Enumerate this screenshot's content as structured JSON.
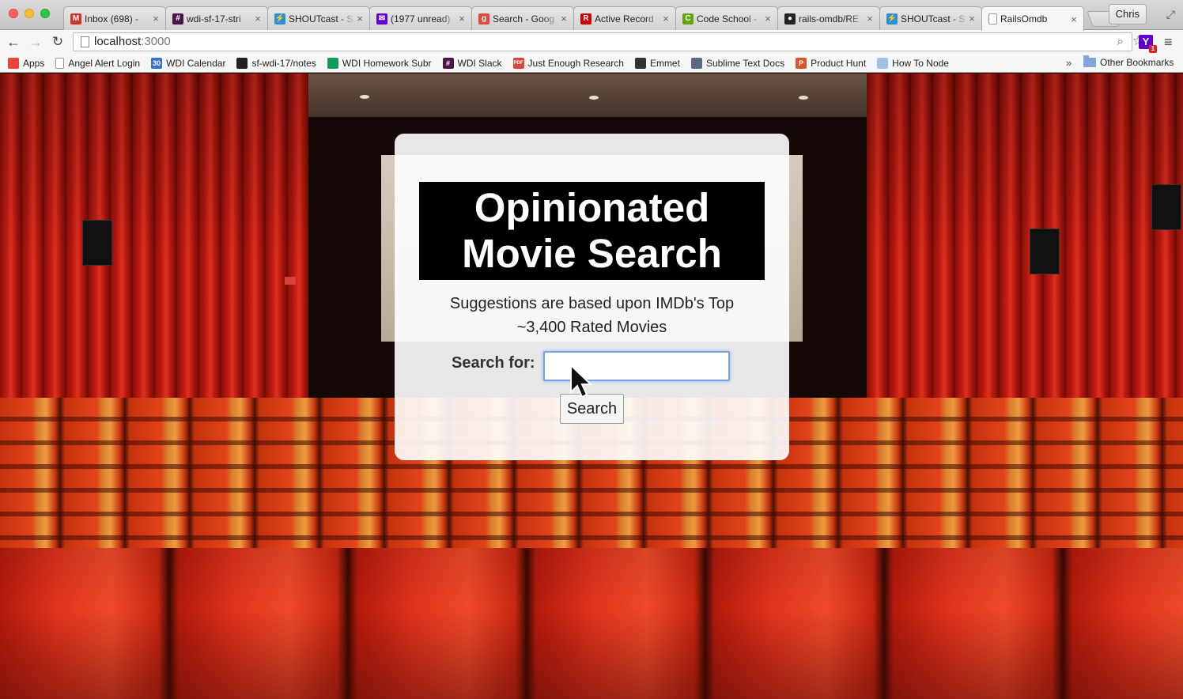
{
  "browser": {
    "tabs": [
      {
        "title": "Inbox (698) - ",
        "favicon": "gmail-icon",
        "color": "#d93025",
        "glyph": "M"
      },
      {
        "title": "wdi-sf-17-stri",
        "favicon": "slack-icon",
        "color": "#4a154b",
        "glyph": "#"
      },
      {
        "title": "SHOUTcast - S",
        "favicon": "shoutcast-icon",
        "color": "#2b8fd6",
        "glyph": "⚡"
      },
      {
        "title": "(1977 unread)",
        "favicon": "yahoo-mail-icon",
        "color": "#5f01d1",
        "glyph": "✉"
      },
      {
        "title": "Search - Goog",
        "favicon": "google-icon",
        "color": "#dd4b39",
        "glyph": "g"
      },
      {
        "title": "Active Record",
        "favicon": "rails-icon",
        "color": "#cc0000",
        "glyph": "R"
      },
      {
        "title": "Code School - ",
        "favicon": "code-school-icon",
        "color": "#62a60a",
        "glyph": "C"
      },
      {
        "title": "rails-omdb/RE",
        "favicon": "github-icon",
        "color": "#222222",
        "glyph": "●"
      },
      {
        "title": "SHOUTcast - S",
        "favicon": "shoutcast-icon",
        "color": "#2b8fd6",
        "glyph": "⚡"
      },
      {
        "title": "RailsOmdb",
        "favicon": "page-icon",
        "color": "#ffffff",
        "glyph": "",
        "active": true
      }
    ],
    "profile_name": "Chris",
    "url_host": "localhost",
    "url_port": ":3000",
    "bookmarks": [
      {
        "label": "Apps",
        "icon": "apps-grid-icon",
        "color": "#e8453c"
      },
      {
        "label": "Angel Alert Login",
        "icon": "page-icon",
        "color": "#ffffff"
      },
      {
        "label": "WDI Calendar",
        "icon": "calendar-icon",
        "color": "#3b6fd1",
        "glyph": "30"
      },
      {
        "label": "sf-wdi-17/notes",
        "icon": "github-icon",
        "color": "#222222"
      },
      {
        "label": "WDI Homework Subr",
        "icon": "sheets-icon",
        "color": "#0f9d58"
      },
      {
        "label": "WDI Slack",
        "icon": "slack-icon",
        "color": "#4a154b",
        "glyph": "#"
      },
      {
        "label": "Just Enough Research",
        "icon": "pdf-icon",
        "color": "#d9473b",
        "glyph": "PDF"
      },
      {
        "label": "Emmet",
        "icon": "emmet-icon",
        "color": "#333333"
      },
      {
        "label": "Sublime Text Docs",
        "icon": "docs-icon",
        "color": "#5a6b80"
      },
      {
        "label": "Product Hunt",
        "icon": "product-hunt-icon",
        "color": "#da552f",
        "glyph": "P"
      },
      {
        "label": "How To Node",
        "icon": "cloud-icon",
        "color": "#9fc3e6"
      }
    ],
    "bookmarks_overflow": "»",
    "other_bookmarks": "Other Bookmarks"
  },
  "page": {
    "title_line1": "Opinionated",
    "title_line2": "Movie Search",
    "subtitle_line1": "Suggestions are based upon IMDb's Top",
    "subtitle_line2": "~3,400 Rated Movies",
    "search_label": "Search for:",
    "search_value": "",
    "search_button": "Search"
  }
}
